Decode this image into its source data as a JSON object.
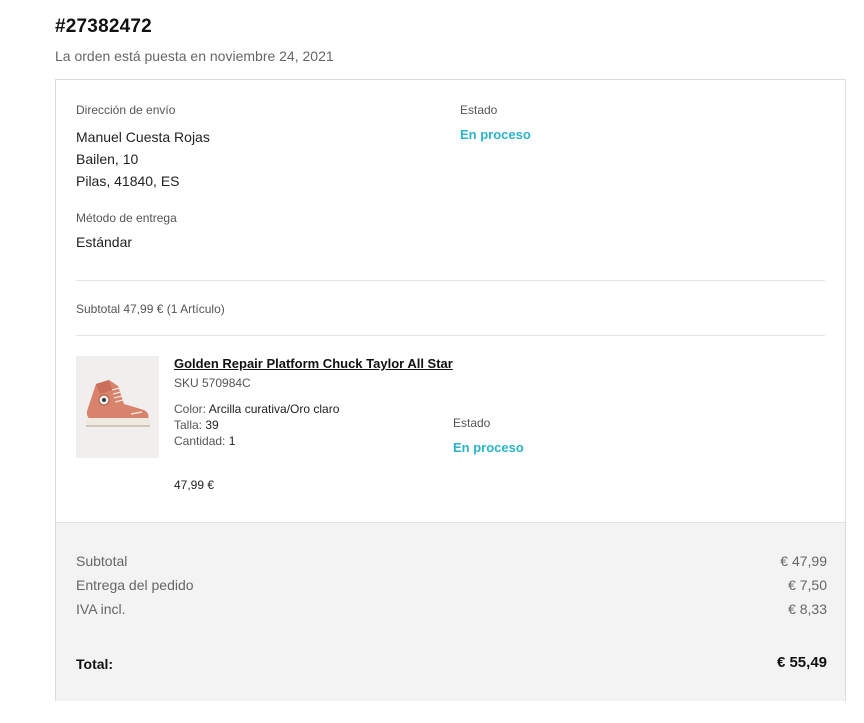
{
  "order": {
    "number": "#27382472",
    "placed_on": "La orden está puesta en noviembre 24, 2021"
  },
  "shipping": {
    "label": "Dirección de envío",
    "name": "Manuel Cuesta Rojas",
    "street": "Bailen, 10",
    "city": "Pilas, 41840, ES"
  },
  "order_status": {
    "label": "Estado",
    "value": "En proceso"
  },
  "delivery": {
    "label": "Método de entrega",
    "value": "Estándar"
  },
  "items_subtotal": "Subtotal 47,99 € (1 Artículo)",
  "product": {
    "name": "Golden Repair Platform Chuck Taylor All Star",
    "sku": "SKU 570984C",
    "color_label": "Color:",
    "color_value": "Arcilla curativa/Oro claro",
    "size_label": "Talla:",
    "size_value": "39",
    "qty_label": "Cantidad:",
    "qty_value": "1",
    "price": "47,99 €",
    "status_label": "Estado",
    "status_value": "En proceso",
    "image_icon": "sneaker-icon"
  },
  "summary": {
    "subtotal_label": "Subtotal",
    "subtotal_value": "€ 47,99",
    "delivery_label": "Entrega del pedido",
    "delivery_value": "€ 7,50",
    "vat_label": "IVA incl.",
    "vat_value": "€ 8,33",
    "total_label": "Total:",
    "total_value": "€ 55,49"
  },
  "colors": {
    "status_accent": "#2bb3c9",
    "shoe": "#d9826c",
    "summary_bg": "#f3f3f3"
  }
}
